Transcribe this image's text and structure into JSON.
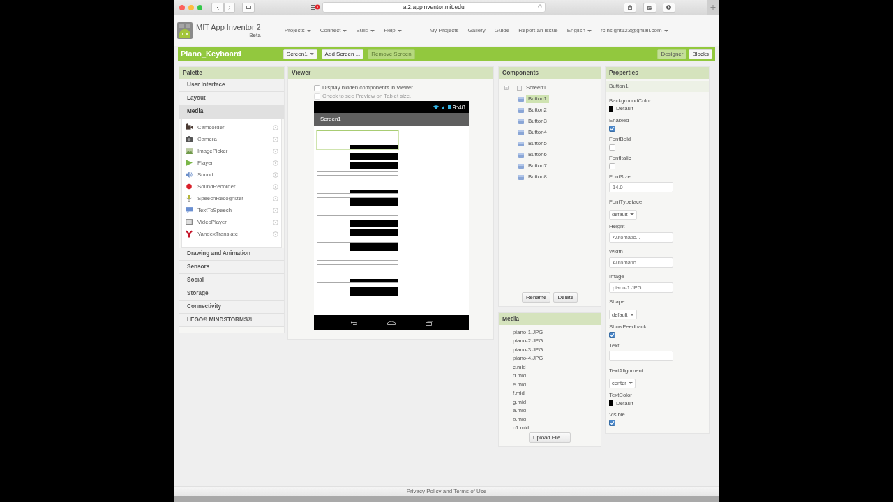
{
  "browser": {
    "url": "ai2.appinventor.mit.edu"
  },
  "app": {
    "title": "MIT App Inventor 2",
    "subtitle": "Beta",
    "menus": [
      {
        "label": "Projects",
        "dropdown": true
      },
      {
        "label": "Connect",
        "dropdown": true
      },
      {
        "label": "Build",
        "dropdown": true
      },
      {
        "label": "Help",
        "dropdown": true
      }
    ],
    "links": [
      {
        "label": "My Projects",
        "dropdown": false
      },
      {
        "label": "Gallery",
        "dropdown": false
      },
      {
        "label": "Guide",
        "dropdown": false
      },
      {
        "label": "Report an Issue",
        "dropdown": false
      },
      {
        "label": "English",
        "dropdown": true
      },
      {
        "label": "rcinsight123@gmail.com",
        "dropdown": true
      }
    ]
  },
  "project": {
    "name": "Piano_Keyboard",
    "screen": "Screen1",
    "buttons": [
      {
        "label": "Add Screen ...",
        "disabled": false
      },
      {
        "label": "Remove Screen",
        "disabled": true
      }
    ],
    "views": [
      {
        "label": "Designer",
        "selected": true
      },
      {
        "label": "Blocks",
        "selected": false
      }
    ]
  },
  "palette": {
    "title": "Palette",
    "categories": [
      {
        "label": "User Interface",
        "expanded": false
      },
      {
        "label": "Layout",
        "expanded": false
      },
      {
        "label": "Media",
        "expanded": true,
        "items": [
          "Camcorder",
          "Camera",
          "ImagePicker",
          "Player",
          "Sound",
          "SoundRecorder",
          "SpeechRecognizer",
          "TextToSpeech",
          "VideoPlayer",
          "YandexTranslate"
        ]
      },
      {
        "label": "Drawing and Animation",
        "expanded": false
      },
      {
        "label": "Sensors",
        "expanded": false
      },
      {
        "label": "Social",
        "expanded": false
      },
      {
        "label": "Storage",
        "expanded": false
      },
      {
        "label": "Connectivity",
        "expanded": false
      },
      {
        "label": "LEGO® MINDSTORMS®",
        "expanded": false
      }
    ]
  },
  "viewer": {
    "title": "Viewer",
    "options": [
      {
        "label": "Display hidden components in Viewer",
        "checked": false,
        "disabled": false
      },
      {
        "label": "Check to see Preview on Tablet size.",
        "checked": false,
        "disabled": true
      }
    ],
    "phone": {
      "time": "9:48",
      "screen_title": "Screen1",
      "keys": [
        {
          "kind": "bottom",
          "selected": true
        },
        {
          "kind": "double",
          "selected": false
        },
        {
          "kind": "bottom",
          "selected": false
        },
        {
          "kind": "top",
          "selected": false
        },
        {
          "kind": "double",
          "selected": false
        },
        {
          "kind": "top",
          "selected": false
        },
        {
          "kind": "bottom",
          "selected": false
        },
        {
          "kind": "top",
          "selected": false
        }
      ]
    }
  },
  "components": {
    "title": "Components",
    "tree": {
      "label": "Screen1",
      "expanded": true,
      "children": [
        {
          "label": "Button1",
          "selected": true
        },
        {
          "label": "Button2",
          "selected": false
        },
        {
          "label": "Button3",
          "selected": false
        },
        {
          "label": "Button4",
          "selected": false
        },
        {
          "label": "Button5",
          "selected": false
        },
        {
          "label": "Button6",
          "selected": false
        },
        {
          "label": "Button7",
          "selected": false
        },
        {
          "label": "Button8",
          "selected": false
        }
      ]
    },
    "buttons": [
      "Rename",
      "Delete"
    ]
  },
  "media": {
    "title": "Media",
    "files": [
      "piano-1.JPG",
      "piano-2.JPG",
      "piano-3.JPG",
      "piano-4.JPG",
      "c.mid",
      "d.mid",
      "e.mid",
      "f.mid",
      "g.mid",
      "a.mid",
      "b.mid",
      "c1.mid"
    ],
    "button": "Upload File ..."
  },
  "properties": {
    "title": "Properties",
    "component": "Button1",
    "items": [
      {
        "kind": "color",
        "label": "BackgroundColor",
        "value": "Default",
        "color": "#000000"
      },
      {
        "kind": "checkbox",
        "label": "Enabled",
        "checked": true
      },
      {
        "kind": "checkbox",
        "label": "FontBold",
        "checked": false
      },
      {
        "kind": "checkbox",
        "label": "FontItalic",
        "checked": false
      },
      {
        "kind": "text",
        "label": "FontSize",
        "value": "14.0"
      },
      {
        "kind": "dropdown",
        "label": "FontTypeface",
        "value": "default"
      },
      {
        "kind": "text",
        "label": "Height",
        "value": "Automatic..."
      },
      {
        "kind": "text",
        "label": "Width",
        "value": "Automatic..."
      },
      {
        "kind": "text",
        "label": "Image",
        "value": "piano-1.JPG..."
      },
      {
        "kind": "dropdown",
        "label": "Shape",
        "value": "default"
      },
      {
        "kind": "checkbox",
        "label": "ShowFeedback",
        "checked": true
      },
      {
        "kind": "text",
        "label": "Text"
      },
      {
        "kind": "dropdown",
        "label": "TextAlignment",
        "value": "center"
      },
      {
        "kind": "color",
        "label": "TextColor",
        "value": "Default",
        "color": "#000000"
      },
      {
        "kind": "checkbox",
        "label": "Visible",
        "checked": true
      }
    ]
  },
  "footer": {
    "link": "Privacy Policy and Terms of Use"
  }
}
